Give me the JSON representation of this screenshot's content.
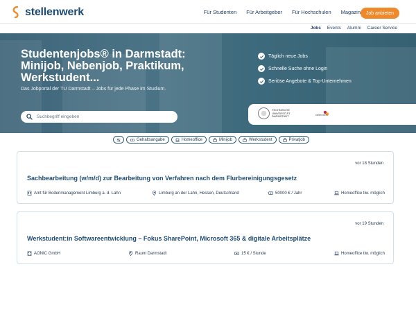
{
  "brand": {
    "name": "stellenwerk",
    "accent": "#ee8a2c",
    "primary": "#1e4b73"
  },
  "nav": {
    "items": [
      "Für Studenten",
      "Für Arbeitgeber",
      "Für Hochschulen",
      "Magazin"
    ],
    "cta": "Job anbieten"
  },
  "subnav": {
    "items": [
      "Jobs",
      "Events",
      "Alumni",
      "Career Service"
    ],
    "active": "Jobs"
  },
  "hero": {
    "title": "Studentenjobs® in Darmstadt: Minijob, Nebenjob, Praktikum, Werkstudent...",
    "subtitle": "Das Jobportal der TU Darmstadt – Jobs für jede Phase im Studium.",
    "search_placeholder": "Suchbegriff eingeben",
    "benefits": [
      "Täglich neue Jobs",
      "Schnelle Suche ohne Login",
      "Seriöse Angebote & Top-Unternehmen"
    ],
    "partner_lines": [
      "TECHNISCHE",
      "UNIVERSITÄT",
      "DARMSTADT"
    ],
    "partner_logo_text": "stellenwerk"
  },
  "filters": [
    "Gehaltsangabe",
    "Homeoffice",
    "Minijob",
    "Werkstudent",
    "Privatjob"
  ],
  "jobs": [
    {
      "posted": "vor 18 Stunden",
      "title": "Sachbearbeitung (w/m/d) zur Bearbeitung von Verfahren nach dem Flurbereinigungsgesetz",
      "company": "Amt für Bodenmanagement Limburg a. d. Lahn",
      "location": "Limburg an der Lahn, Hessen, Deutschland",
      "salary": "50000 € / Jahr",
      "remote": "Homeoffice tlw. möglich"
    },
    {
      "posted": "vor 19 Stunden",
      "title": "Werkstudent:in Softwareentwicklung – Fokus SharePoint, Microsoft 365 & digitale Arbeitsplätze",
      "company": "AONIC GmbH",
      "location": "Raum Darmstadt",
      "salary": "15 € / Stunde",
      "remote": "Homeoffice tlw. möglich"
    }
  ]
}
